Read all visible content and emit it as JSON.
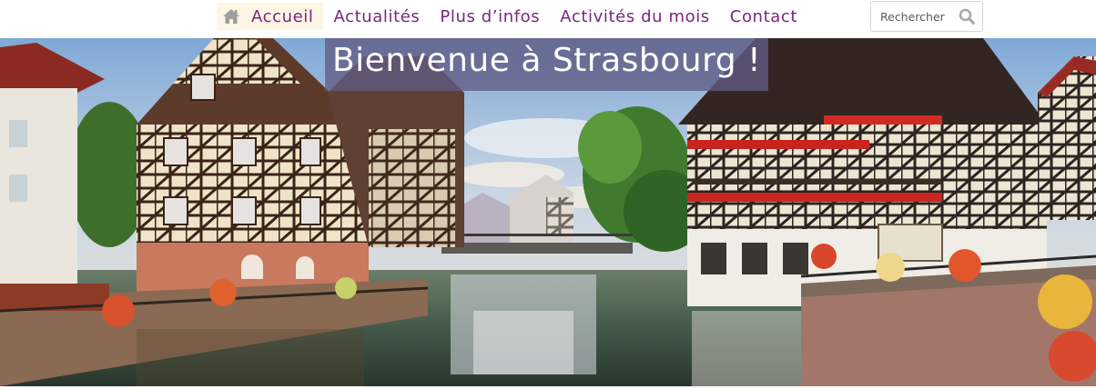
{
  "nav": {
    "items": [
      {
        "label": "Accueil",
        "active": true,
        "icon": "home-icon"
      },
      {
        "label": "Actualités"
      },
      {
        "label": "Plus d’infos"
      },
      {
        "label": "Activités du mois"
      },
      {
        "label": "Contact"
      }
    ]
  },
  "search": {
    "placeholder": "Rechercher",
    "icon": "search-icon"
  },
  "hero": {
    "title": "Bienvenue à Strasbourg !",
    "image": "strasbourg-petite-france-canal"
  },
  "colors": {
    "nav_text": "#7a2582",
    "active_bg": "#fdf6e4",
    "title_overlay": "#625c84"
  }
}
